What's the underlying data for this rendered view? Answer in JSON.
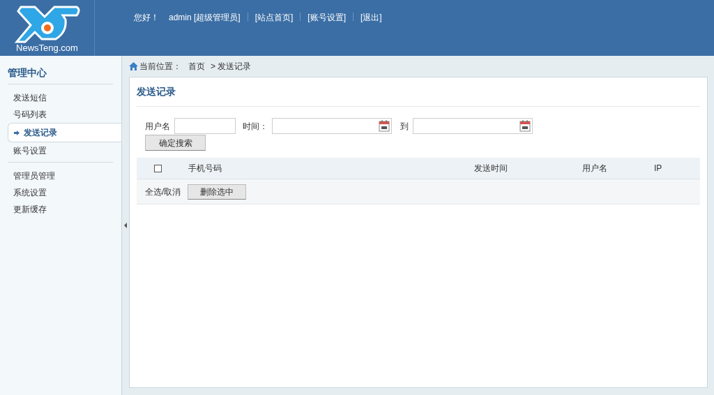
{
  "header": {
    "logo_text": "NewsTeng.com",
    "greeting": "您好！",
    "user": "admin [超级管理员]",
    "links": [
      "[站点首页]",
      "[账号设置]",
      "[退出]"
    ]
  },
  "sidebar": {
    "title": "管理中心",
    "groups": [
      [
        {
          "label": "发送短信",
          "selected": false
        },
        {
          "label": "号码列表",
          "selected": false
        },
        {
          "label": "发送记录",
          "selected": true
        },
        {
          "label": "账号设置",
          "selected": false
        }
      ],
      [
        {
          "label": "管理员管理",
          "selected": false
        },
        {
          "label": "系统设置",
          "selected": false
        },
        {
          "label": "更新缓存",
          "selected": false
        }
      ]
    ]
  },
  "breadcrumb": {
    "label": "当前位置：",
    "items": [
      "首页",
      "> 发送记录"
    ]
  },
  "panel": {
    "title": "发送记录",
    "search": {
      "username_label": "用户名",
      "time_label": "时间：",
      "to_label": "到",
      "button": "确定搜索"
    },
    "table": {
      "columns": [
        "手机号码",
        "",
        "发送时间",
        "用户名",
        "IP"
      ],
      "select_all": {
        "checked": false
      }
    },
    "footer": {
      "label": "全选/取消",
      "button": "删除选中"
    }
  }
}
